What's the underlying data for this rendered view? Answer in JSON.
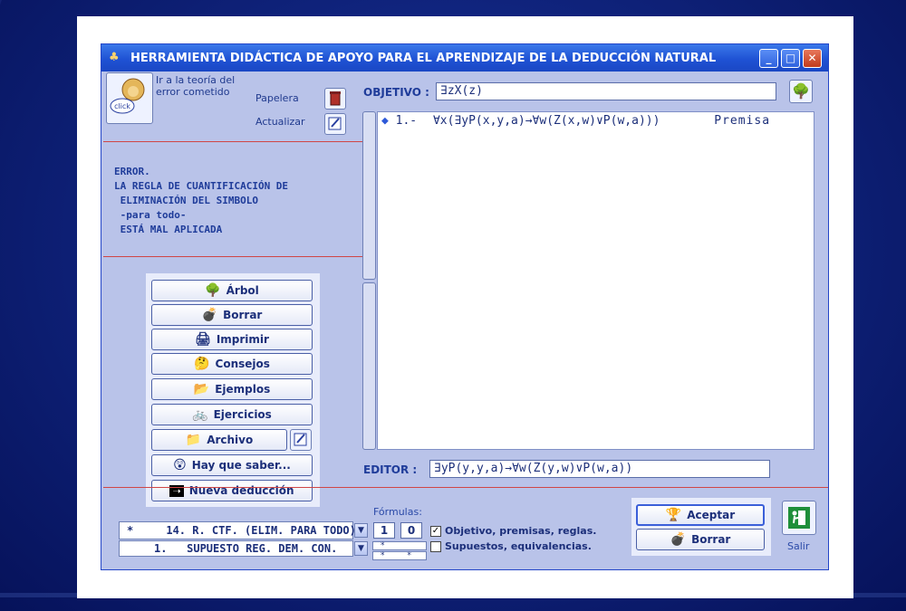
{
  "window": {
    "title": "HERRAMIENTA DIDÁCTICA DE APOYO PARA EL APRENDIZAJE DE LA DEDUCCIÓN NATURAL",
    "controls": [
      "_",
      "□",
      "✕"
    ]
  },
  "top_left": {
    "click_label": "click",
    "theory_text_line1": "Ir a la teoría del",
    "theory_text_line2": "error cometido",
    "trash_label": "Papelera",
    "update_label": "Actualizar"
  },
  "error_message": "ERROR.\nLA REGLA DE CUANTIFICACIÓN DE\n ELIMINACIÓN DEL SIMBOLO\n -para todo-\n ESTÁ MAL APLICADA",
  "side_buttons": [
    {
      "label": "Árbol",
      "icon": "tree-icon"
    },
    {
      "label": "Borrar",
      "icon": "bomb-icon"
    },
    {
      "label": "Imprimir",
      "icon": "printer-icon"
    },
    {
      "label": "Consejos",
      "icon": "smiley-icon"
    },
    {
      "label": "Ejemplos",
      "icon": "folder-icon"
    },
    {
      "label": "Ejercicios",
      "icon": "bicycle-icon"
    },
    {
      "label": "Archivo",
      "icon": "file-icon"
    },
    {
      "label": "Hay que saber...",
      "icon": "face-icon"
    },
    {
      "label": "Nueva deducción",
      "icon": "swoosh-icon"
    }
  ],
  "objetivo": {
    "label": "OBJETIVO :",
    "value": "∃zX(z)"
  },
  "premises": [
    {
      "number": "1.-",
      "formula": "∀x(∃yP(x,y,a)→∀w(Z(x,w)∨P(w,a)))",
      "type": "Premisa"
    }
  ],
  "editor": {
    "label": "EDITOR :",
    "value": "∃yP(y,y,a)→∀w(Z(y,w)∨P(w,a))"
  },
  "bottom": {
    "formulas_label": "Fórmulas:",
    "rule_select_1": "*     14. R. CTF. (ELIM. PARA TODO)",
    "rule_select_2": "1.   SUPUESTO REG. DEM. CON.",
    "num1": "1",
    "num2": "0",
    "star_box_1": "*",
    "star_box_2a": "*",
    "star_box_2b": "*",
    "check1_label": "Objetivo, premisas, reglas.",
    "check1_checked": "✓",
    "check2_label": "Supuestos, equivalencias."
  },
  "actions": {
    "accept_label": "Aceptar",
    "delete_label": "Borrar",
    "exit_label": "Salir"
  }
}
